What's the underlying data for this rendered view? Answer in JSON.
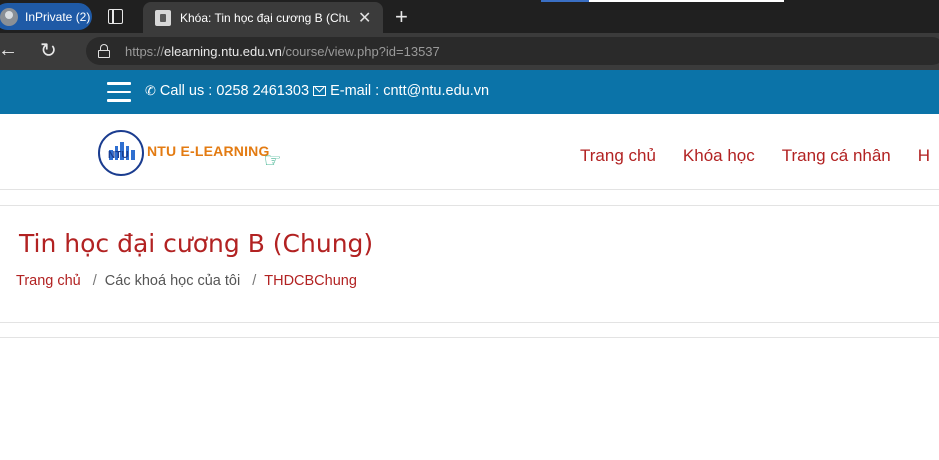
{
  "browser": {
    "inprivate_label": "InPrivate (2)",
    "tab_title": "Khóa: Tin học đại cương B (Chung)",
    "tab_close": "✕",
    "new_tab": "+",
    "url_proto": "https://",
    "url_host": "elearning.ntu.edu.vn",
    "url_path": "/course/view.php?id=13537"
  },
  "topbar": {
    "phone": "Call us : 0258 2461303",
    "email": "E-mail : cntt@ntu.edu.vn"
  },
  "header": {
    "logo_text": "NTU E-LEARNING",
    "logo_badge": "NTU",
    "nav": [
      "Trang chủ",
      "Khóa học",
      "Trang cá nhân",
      "H"
    ]
  },
  "page": {
    "title": "Tin học đại cương B (Chung)",
    "breadcrumb": [
      "Trang chủ",
      "Các khoá học của tôi",
      "THDCBChung"
    ],
    "separator": "/"
  },
  "colors": {
    "topbar": "#0b73a8",
    "accent": "#b22222",
    "logo": "#e37b12"
  }
}
